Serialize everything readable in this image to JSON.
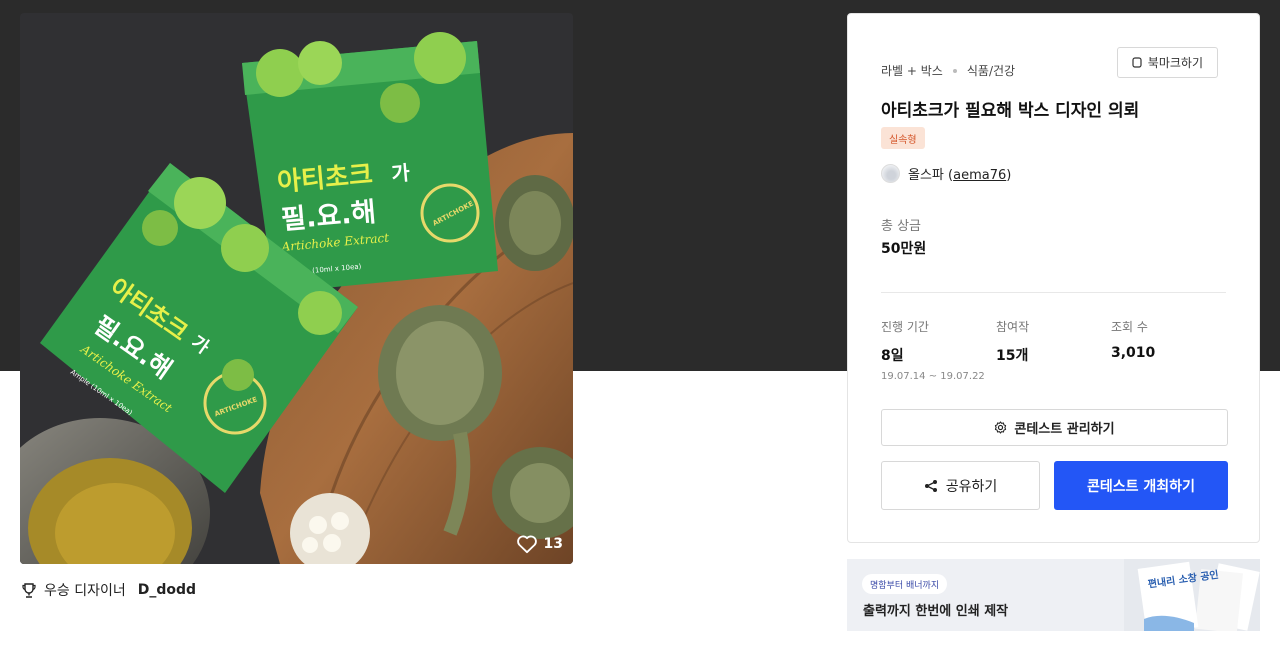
{
  "image": {
    "alt_icon": "heart-icon",
    "like_count": "13",
    "box_text": {
      "title_line1_a": "아티초크",
      "title_line1_b": "가",
      "title_line2": "필.요.해",
      "subtitle": "Artichoke Extract",
      "seal": "ARTICHOKE",
      "spec": "Ample (10ml x 10ea)"
    }
  },
  "winner": {
    "icon": "trophy-icon",
    "label": "우승 디자이너",
    "name": "D_dodd"
  },
  "card": {
    "breadcrumb": [
      "라벨 + 박스",
      "식품/건강"
    ],
    "bookmark_label": "북마크하기",
    "title": "아티초크가 필요해 박스 디자인 의뢰",
    "badge": "실속형",
    "author_name": "올스파",
    "author_id": "aema76",
    "prize_label": "총 상금",
    "prize_value": "50만원",
    "stats": [
      {
        "label": "진행 기간",
        "value": "8일",
        "sub": "19.07.14 ~ 19.07.22"
      },
      {
        "label": "참여작",
        "value": "15개",
        "sub": ""
      },
      {
        "label": "조회 수",
        "value": "3,010",
        "sub": ""
      }
    ],
    "manage_label": "콘테스트 관리하기",
    "share_label": "공유하기",
    "host_label": "콘테스트 개최하기",
    "accent_color": "#2356f6"
  },
  "banner": {
    "tag": "명함부터 배너까지",
    "text": "출력까지 한번에 인쇄 제작",
    "art_text": "편내리 소창 공인"
  }
}
